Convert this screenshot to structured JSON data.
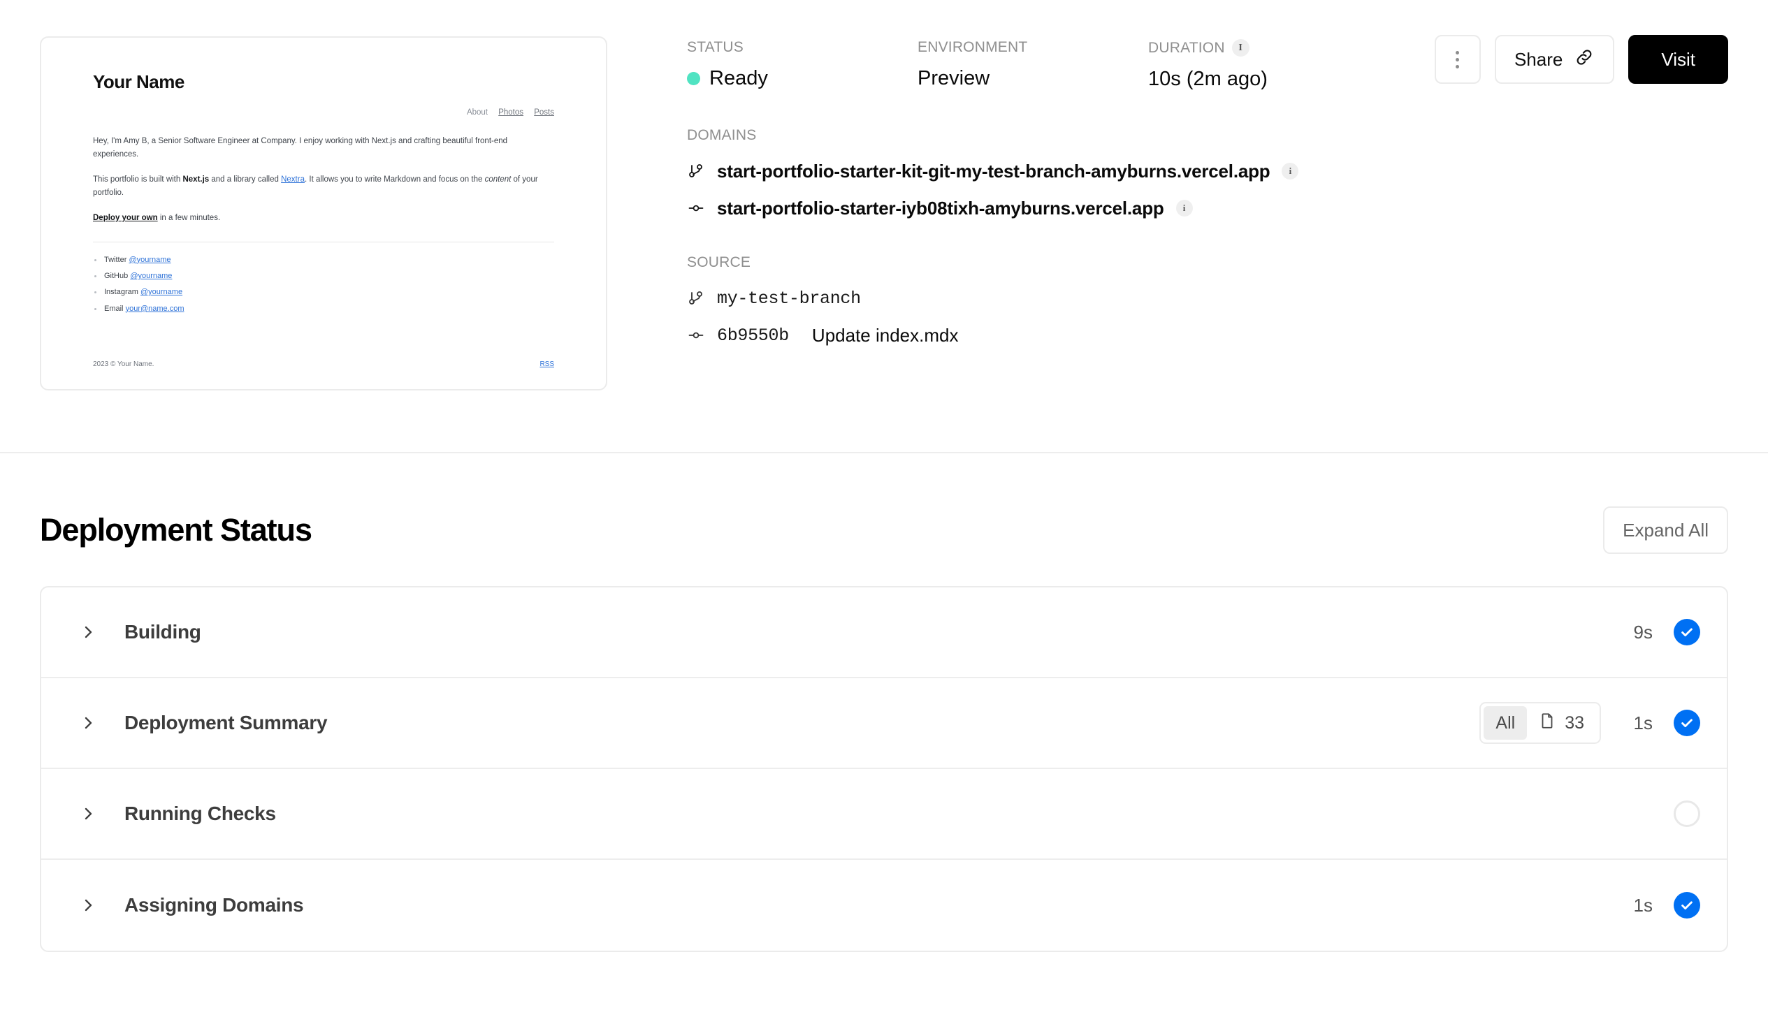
{
  "preview": {
    "name": "Your Name",
    "nav": [
      "About",
      "Photos",
      "Posts"
    ],
    "para1_a": "Hey, I'm Amy B, a Senior Software Engineer at Company. I enjoy working with Next.js and crafting beautiful front-end experiences.",
    "para2_pre": "This portfolio is built with ",
    "para2_bold": "Next.js",
    "para2_mid": " and a library called ",
    "para2_link": "Nextra",
    "para2_post": ". It allows you to write Markdown and focus on the ",
    "para2_italic": "content",
    "para2_end": " of your portfolio.",
    "para3_link": "Deploy your own",
    "para3_rest": " in a few minutes.",
    "links": [
      {
        "label": "Twitter",
        "handle": "@yourname"
      },
      {
        "label": "GitHub",
        "handle": "@yourname"
      },
      {
        "label": "Instagram",
        "handle": "@yourname"
      },
      {
        "label": "Email",
        "handle": "your@name.com"
      }
    ],
    "copyright": "2023 © Your Name.",
    "rss": "RSS"
  },
  "meta": {
    "status": {
      "label": "STATUS",
      "value": "Ready",
      "dot_color": "#50e3c2"
    },
    "environment": {
      "label": "ENVIRONMENT",
      "value": "Preview"
    },
    "duration": {
      "label": "DURATION",
      "value": "10s (2m ago)",
      "info": "i"
    }
  },
  "actions": {
    "more_label": "more-options",
    "share_label": "Share",
    "visit_label": "Visit"
  },
  "domains": {
    "label": "DOMAINS",
    "items": [
      {
        "icon": "git-branch-icon",
        "text": "start-portfolio-starter-kit-git-my-test-branch-amyburns.vercel.app",
        "info": "i"
      },
      {
        "icon": "git-commit-icon",
        "text": "start-portfolio-starter-iyb08tixh-amyburns.vercel.app",
        "info": "i"
      }
    ]
  },
  "source": {
    "label": "SOURCE",
    "branch": {
      "icon": "git-branch-icon",
      "text": "my-test-branch"
    },
    "commit": {
      "icon": "git-commit-icon",
      "hash": "6b9550b",
      "message": "Update index.mdx"
    }
  },
  "deployment_status": {
    "title": "Deployment Status",
    "expand_all": "Expand All",
    "steps": [
      {
        "name": "Building",
        "duration": "9s",
        "state": "complete",
        "badge": null
      },
      {
        "name": "Deployment Summary",
        "duration": "1s",
        "state": "complete",
        "badge": {
          "all": "All",
          "count": "33"
        }
      },
      {
        "name": "Running Checks",
        "duration": "",
        "state": "pending",
        "badge": null
      },
      {
        "name": "Assigning Domains",
        "duration": "1s",
        "state": "complete",
        "badge": null
      }
    ]
  },
  "colors": {
    "accent_blue": "#0070f3",
    "ready_green": "#50e3c2",
    "border": "#ebebeb"
  }
}
